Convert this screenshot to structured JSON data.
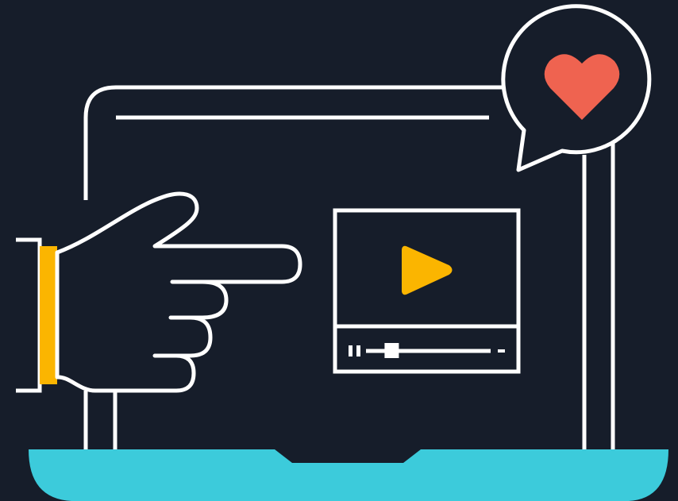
{
  "colors": {
    "background": "#161d2a",
    "outline": "#ffffff",
    "laptop_base": "#3ccbdb",
    "play_icon": "#fbb500",
    "cuff": "#fbb500",
    "heart": "#ef6350"
  },
  "icons": {
    "pointer": "pointing-hand-icon",
    "reaction": "heart-icon",
    "media": "play-icon"
  },
  "video_player": {
    "progress_fraction": 0.2
  }
}
